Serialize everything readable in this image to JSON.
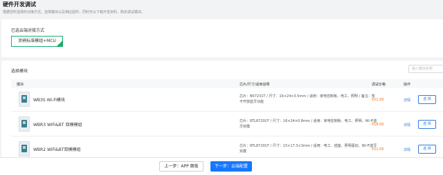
{
  "header": {
    "title": "硬件开发调试",
    "description": "根据您所选择的对接方式，选择模块以及相应固件，同时可以下载开发资料，购买调试模块。"
  },
  "access_method": {
    "label": "已选云端对接方式",
    "selected": "涂鸦标准模组+MCU"
  },
  "modules": {
    "label": "选择模块",
    "search_placeholder": "输入模块名称",
    "columns": [
      "模块",
      "芯片/尺寸/适用说明",
      "调试价格",
      "操作"
    ],
    "rows": [
      {
        "name": "WB3S Wi-Fi模块",
        "spec": "芯片：BK7231T / 尺寸：16×24×3.5mm / 适用：家电控制板、电工、照明 / 备注：暂不开放蓝牙功能",
        "price": "¥21.00",
        "detail": "详情",
        "select": "选 择"
      },
      {
        "name": "WBR3 WiFi&BT 双模模组",
        "spec": "芯片：RTL8720CF / 尺寸：16×24×0.8mm / 适用：家电控制板、电工、照明、Wi-Fi蓝牙双模",
        "price": "¥18.00",
        "detail": "详情",
        "select": "选 择"
      },
      {
        "name": "WBR2 WiFi&BT双模模组",
        "spec": "芯片：RTL8720CF / 尺寸：15×17.3×3mm / 适用：电工、插座、照明驱动、Wi-Fi蓝牙双模",
        "price": "¥21.00",
        "detail": "详情",
        "select": "选 择"
      }
    ]
  },
  "footer": {
    "prev_label": "上一步：APP 面板",
    "next_label": "下一步：云端配置"
  },
  "colors": {
    "accent": "#1677ff",
    "selected_border": "#1aad6e",
    "price": "#ff6a00",
    "link": "#2f7bd8"
  },
  "icons": {
    "selected_mark": "checkmark-corner-icon",
    "module_thumbnail": "module-board-icon"
  }
}
